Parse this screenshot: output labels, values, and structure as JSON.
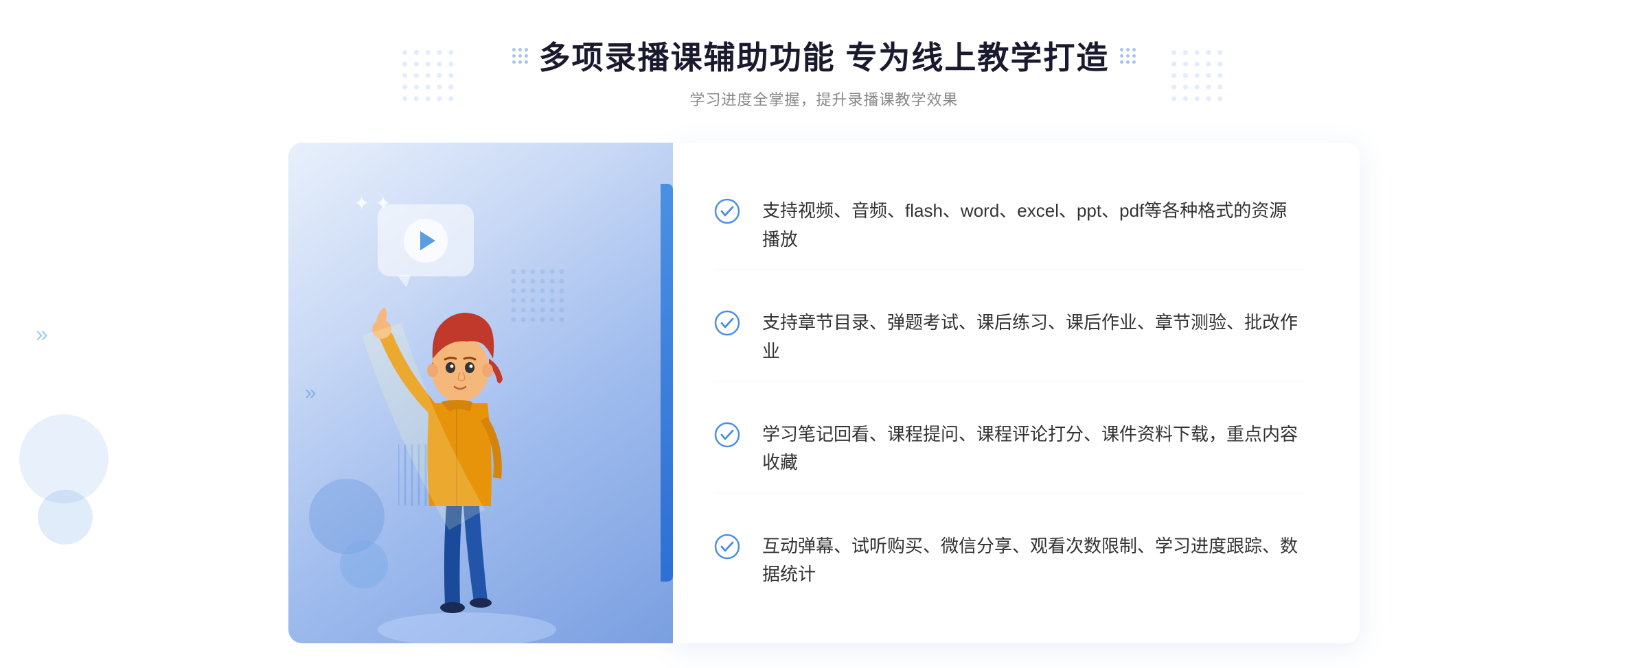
{
  "header": {
    "title": "多项录播课辅助功能 专为线上教学打造",
    "subtitle": "学习进度全掌握，提升录播课教学效果"
  },
  "features": [
    {
      "id": 1,
      "text": "支持视频、音频、flash、word、excel、ppt、pdf等各种格式的资源播放"
    },
    {
      "id": 2,
      "text": "支持章节目录、弹题考试、课后练习、课后作业、章节测验、批改作业"
    },
    {
      "id": 3,
      "text": "学习笔记回看、课程提问、课程评论打分、课件资料下载，重点内容收藏"
    },
    {
      "id": 4,
      "text": "互动弹幕、试听购买、微信分享、观看次数限制、学习进度跟踪、数据统计"
    }
  ],
  "illustration": {
    "play_icon": "▶",
    "sparkle": "✦",
    "arrows_left": "»"
  },
  "colors": {
    "accent_blue": "#4a90e2",
    "dark_blue": "#2e6fd4",
    "text_dark": "#1a1a2e",
    "text_gray": "#888888",
    "text_feature": "#333333"
  }
}
